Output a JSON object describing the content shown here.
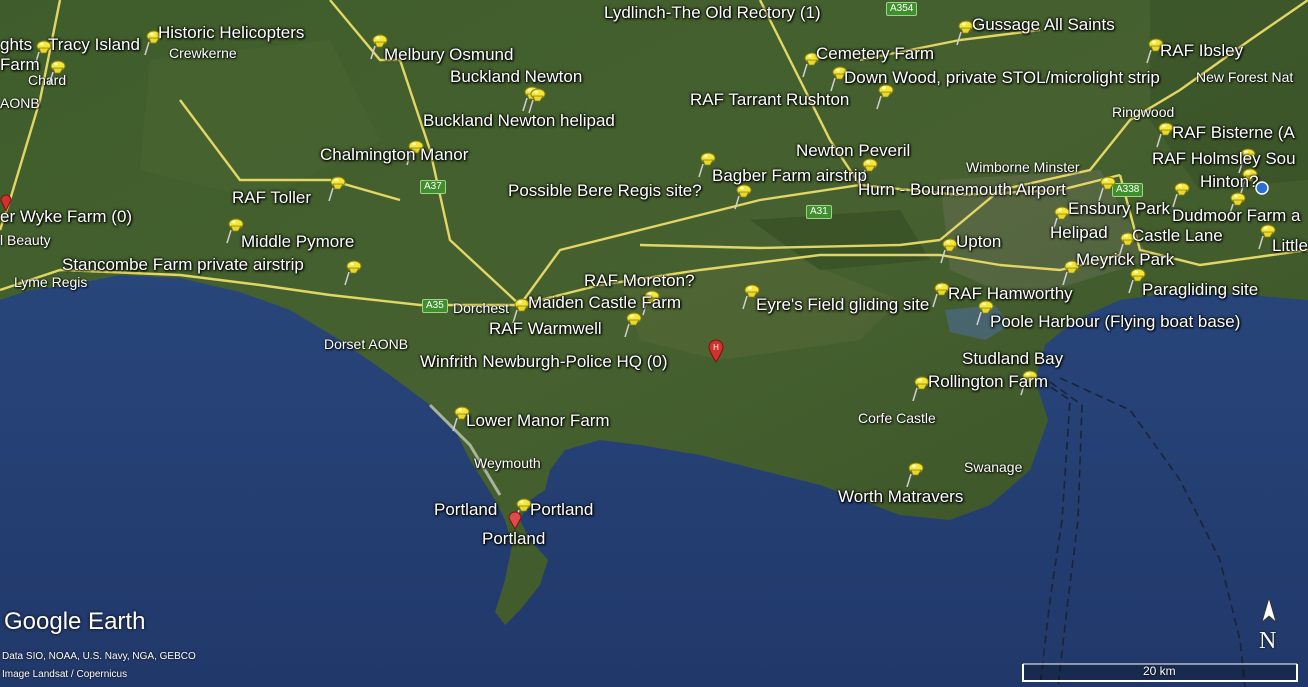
{
  "app": {
    "logo_text": "Google Earth",
    "credit_data": "Data SIO, NOAA, U.S. Navy, NGA, GEBCO",
    "credit_image": "Image Landsat / Copernicus",
    "scale_label": "20 km",
    "compass_label": "N"
  },
  "places": [
    {
      "id": "tracy-island",
      "label": "Tracy Island"
    },
    {
      "id": "historic-helicopters",
      "label": "Historic Helicopters"
    },
    {
      "id": "lydlinch",
      "label": "Lydlinch-The Old Rectory (1)"
    },
    {
      "id": "gussage",
      "label": "Gussage All Saints"
    },
    {
      "id": "raf-ibsley",
      "label": "RAF Ibsley"
    },
    {
      "id": "melbury",
      "label": "Melbury Osmund"
    },
    {
      "id": "cemetery-farm",
      "label": "Cemetery Farm"
    },
    {
      "id": "buckland-newton",
      "label": "Buckland Newton"
    },
    {
      "id": "down-wood",
      "label": "Down Wood, private STOL/microlight strip"
    },
    {
      "id": "raf-tarrant",
      "label": "RAF Tarrant Rushton"
    },
    {
      "id": "buckland-helipad",
      "label": "Buckland Newton helipad"
    },
    {
      "id": "raf-bisterne",
      "label": "RAF Bisterne (A"
    },
    {
      "id": "chalmington",
      "label": "Chalmington Manor"
    },
    {
      "id": "newton-peveril",
      "label": "Newton Peveril"
    },
    {
      "id": "raf-holmsley",
      "label": "RAF Holmsley Sou"
    },
    {
      "id": "bagber",
      "label": "Bagber Farm airstrip"
    },
    {
      "id": "hinton",
      "label": "Hinton?"
    },
    {
      "id": "raf-toller",
      "label": "RAF Toller"
    },
    {
      "id": "bere-regis",
      "label": "Possible Bere Regis site?"
    },
    {
      "id": "hurn",
      "label": "Hurn - Bournemouth Airport"
    },
    {
      "id": "wyke-farm",
      "label": "er Wyke Farm (0)"
    },
    {
      "id": "ensbury",
      "label": "Ensbury Park"
    },
    {
      "id": "dudmoor",
      "label": "Dudmoor Farm a"
    },
    {
      "id": "helipad",
      "label": "Helipad"
    },
    {
      "id": "castle-lane",
      "label": "Castle Lane"
    },
    {
      "id": "little",
      "label": "Little"
    },
    {
      "id": "middle-pymore",
      "label": "Middle Pymore"
    },
    {
      "id": "upton",
      "label": "Upton"
    },
    {
      "id": "stancombe",
      "label": "Stancombe Farm private airstrip"
    },
    {
      "id": "meyrick",
      "label": "Meyrick Park"
    },
    {
      "id": "raf-moreton",
      "label": "RAF Moreton?"
    },
    {
      "id": "paragliding",
      "label": "Paragliding site"
    },
    {
      "id": "raf-hamworthy",
      "label": "RAF Hamworthy"
    },
    {
      "id": "maiden-castle",
      "label": "Maiden Castle Farm"
    },
    {
      "id": "eyres-field",
      "label": "Eyre's Field gliding site"
    },
    {
      "id": "poole-harbour",
      "label": "Poole Harbour (Flying boat base)"
    },
    {
      "id": "raf-warmwell",
      "label": "RAF Warmwell"
    },
    {
      "id": "studland",
      "label": "Studland Bay"
    },
    {
      "id": "winfrith",
      "label": "Winfrith Newburgh-Police HQ (0)"
    },
    {
      "id": "rollington",
      "label": "Rollington Farm"
    },
    {
      "id": "lower-manor",
      "label": "Lower Manor Farm"
    },
    {
      "id": "worth-matravers",
      "label": "Worth Matravers"
    },
    {
      "id": "portland-a",
      "label": "Portland"
    },
    {
      "id": "portland-b",
      "label": "Portland"
    },
    {
      "id": "portland-c",
      "label": "Portland"
    },
    {
      "id": "ghts",
      "label": "ghts"
    },
    {
      "id": "farm-left",
      "label": "Farm"
    }
  ],
  "towns": {
    "crewkerne": "Crewkerne",
    "chard": "Chard",
    "aonb": "AONB",
    "ringwood": "Ringwood",
    "new_forest": "New Forest Nat",
    "wimborne": "Wimborne Minster",
    "beauty": "l Beauty",
    "lyme_regis": "Lyme Regis",
    "dorchester": "Dorchest",
    "dorset_aonb": "Dorset AONB",
    "corfe_castle": "Corfe Castle",
    "weymouth": "Weymouth",
    "swanage": "Swanage"
  },
  "roads": {
    "a354": "A354",
    "a37": "A37",
    "a31": "A31",
    "a338": "A338",
    "a35": "A35"
  }
}
